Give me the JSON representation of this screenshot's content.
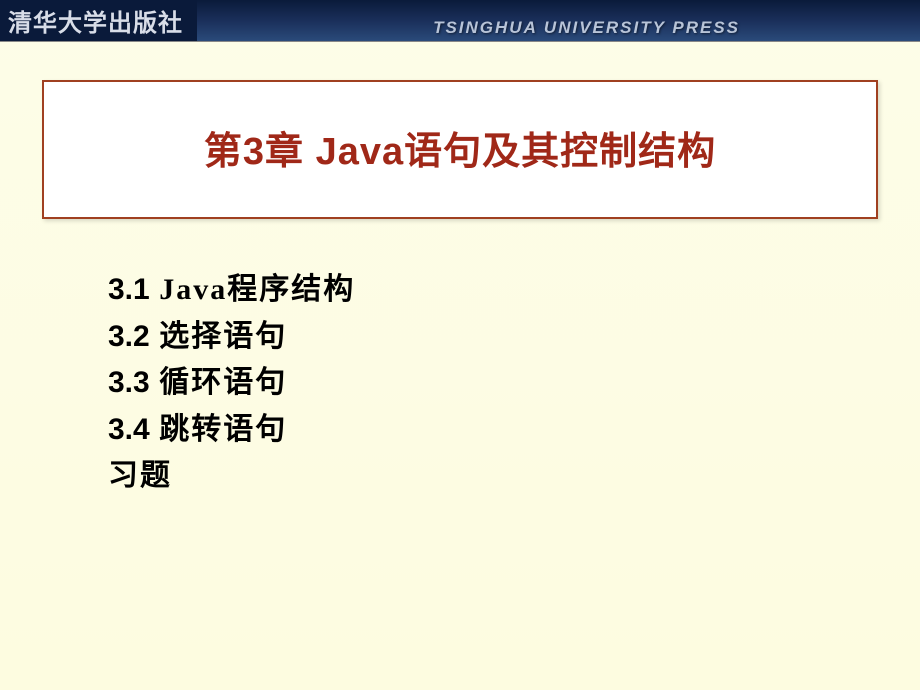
{
  "header": {
    "logo": "清华大学出版社",
    "subtitle": "TSINGHUA UNIVERSITY PRESS"
  },
  "chapter": {
    "title": "第3章  Java语句及其控制结构"
  },
  "toc": {
    "items": [
      {
        "num": "3.1",
        "label": "  Java程序结构"
      },
      {
        "num": "3.2",
        "label": "  选择语句"
      },
      {
        "num": "3.3",
        "label": "  循环语句"
      },
      {
        "num": "3.4",
        "label": "  跳转语句"
      },
      {
        "num": "",
        "label": "习题"
      }
    ]
  }
}
